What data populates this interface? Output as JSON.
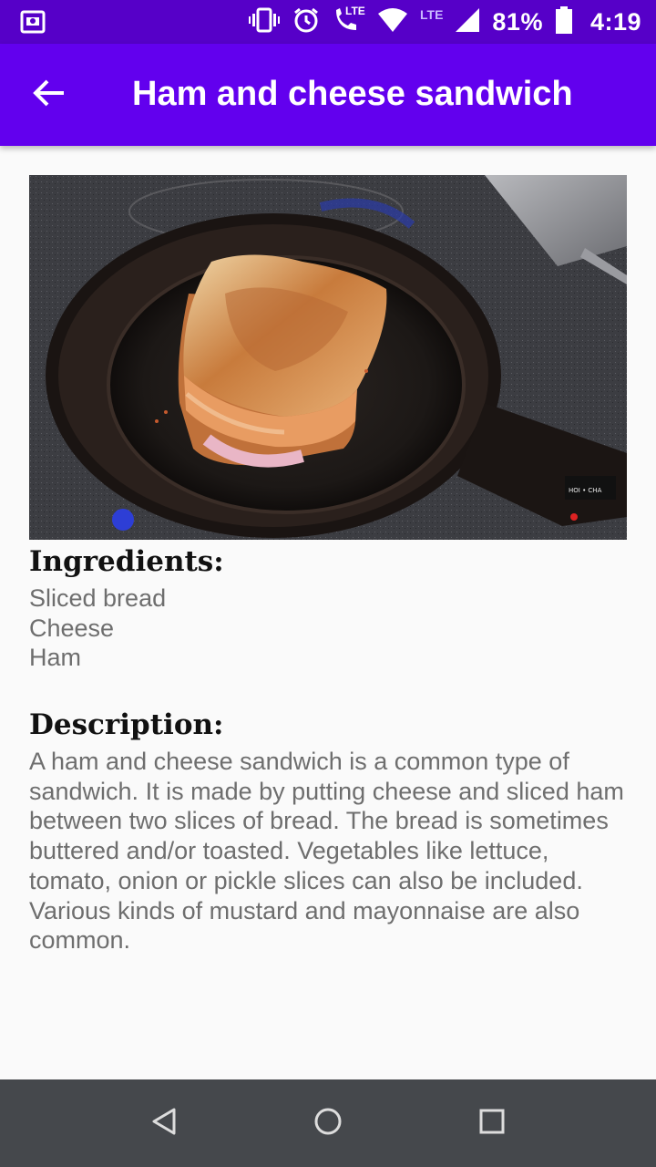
{
  "status_bar": {
    "battery_percent": "81%",
    "time": "4:19",
    "lte_label": "LTE",
    "call_lte_label": "LTE",
    "icons": [
      "screen-record-icon",
      "vibrate-icon",
      "alarm-icon",
      "volte-call-icon",
      "wifi-icon",
      "cell-signal-icon",
      "battery-icon"
    ]
  },
  "app_bar": {
    "title": "Ham and cheese sandwich",
    "back_icon": "arrow-back-icon"
  },
  "content": {
    "image_description_icon": "ham-and-cheese-sandwich-in-skillet-photo",
    "ingredients_heading": "Ingredients:",
    "ingredients": [
      "Sliced bread",
      "Cheese",
      "Ham"
    ],
    "description_heading": "Description:",
    "description": "A ham and cheese sandwich is a common type of sandwich. It is made by putting cheese and sliced ham between two slices of bread. The bread is sometimes buttered and/or toasted. Vegetables like lettuce, tomato, onion or pickle slices can also be included. Various kinds of mustard and mayonnaise are also common."
  },
  "nav_bar": {
    "icons": [
      "nav-back-icon",
      "nav-home-icon",
      "nav-recents-icon"
    ]
  },
  "colors": {
    "status_bar": "#5600c8",
    "app_bar": "#6200ee",
    "nav_bar": "#45484c",
    "body_text": "#6e6e6e"
  }
}
